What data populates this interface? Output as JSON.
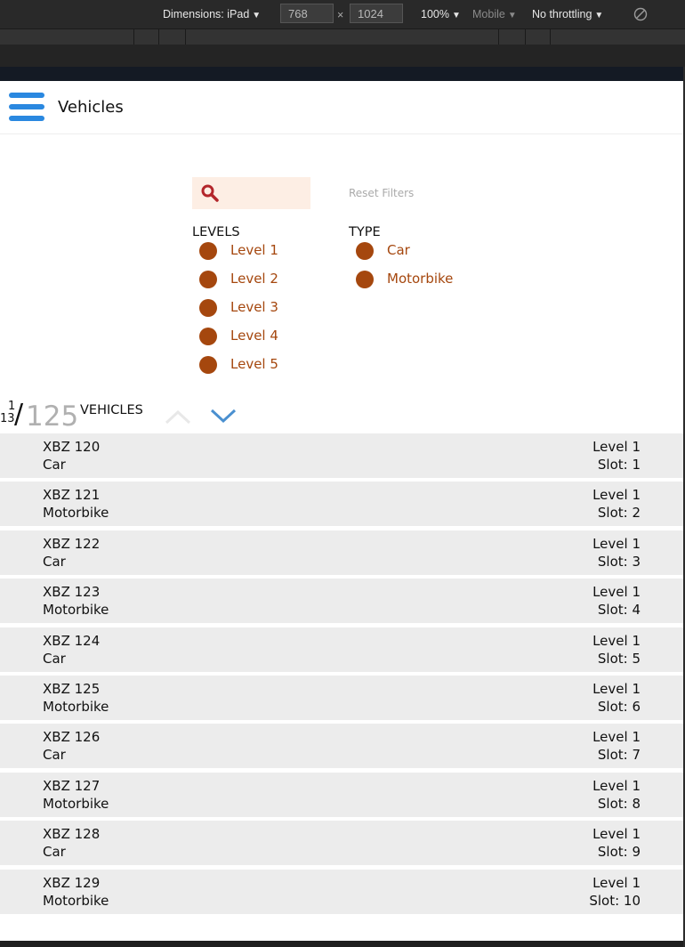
{
  "devtools": {
    "dimensions_label": "Dimensions: iPad",
    "width_value": "768",
    "times": "×",
    "height_value": "1024",
    "zoom": "100%",
    "mode": "Mobile",
    "throttling": "No throttling",
    "caret": "▼"
  },
  "app": {
    "title": "Vehicles"
  },
  "filters": {
    "search_value": "",
    "reset_label": "Reset Filters",
    "levels_heading": "LEVELS",
    "levels": [
      "Level 1",
      "Level 2",
      "Level 3",
      "Level 4",
      "Level 5"
    ],
    "type_heading": "TYPE",
    "types": [
      "Car",
      "Motorbike"
    ],
    "accent_color": "#a5470e"
  },
  "counter": {
    "current": "1",
    "pages": "13",
    "slash": "/",
    "total": "125",
    "label": "VEHICLES"
  },
  "vehicles": [
    {
      "plate": "XBZ 120",
      "type": "Car",
      "level": "Level 1",
      "slot": "Slot: 1"
    },
    {
      "plate": "XBZ 121",
      "type": "Motorbike",
      "level": "Level 1",
      "slot": "Slot: 2"
    },
    {
      "plate": "XBZ 122",
      "type": "Car",
      "level": "Level 1",
      "slot": "Slot: 3"
    },
    {
      "plate": "XBZ 123",
      "type": "Motorbike",
      "level": "Level 1",
      "slot": "Slot: 4"
    },
    {
      "plate": "XBZ 124",
      "type": "Car",
      "level": "Level 1",
      "slot": "Slot: 5"
    },
    {
      "plate": "XBZ 125",
      "type": "Motorbike",
      "level": "Level 1",
      "slot": "Slot: 6"
    },
    {
      "plate": "XBZ 126",
      "type": "Car",
      "level": "Level 1",
      "slot": "Slot: 7"
    },
    {
      "plate": "XBZ 127",
      "type": "Motorbike",
      "level": "Level 1",
      "slot": "Slot: 8"
    },
    {
      "plate": "XBZ 128",
      "type": "Car",
      "level": "Level 1",
      "slot": "Slot: 9"
    },
    {
      "plate": "XBZ 129",
      "type": "Motorbike",
      "level": "Level 1",
      "slot": "Slot: 10"
    }
  ],
  "icons": {
    "menu": "hamburger-menu-icon",
    "search": "search-icon",
    "up": "chevron-up-icon",
    "down": "chevron-down-icon",
    "rotate": "rotate-icon"
  },
  "colors": {
    "menu_blue": "#2a88e0",
    "search_bg": "#fdeee4",
    "search_icon": "#b3262b",
    "row_bg": "#ececec",
    "chevron_down": "#4a90d0",
    "chevron_up": "#e8e8e8"
  }
}
